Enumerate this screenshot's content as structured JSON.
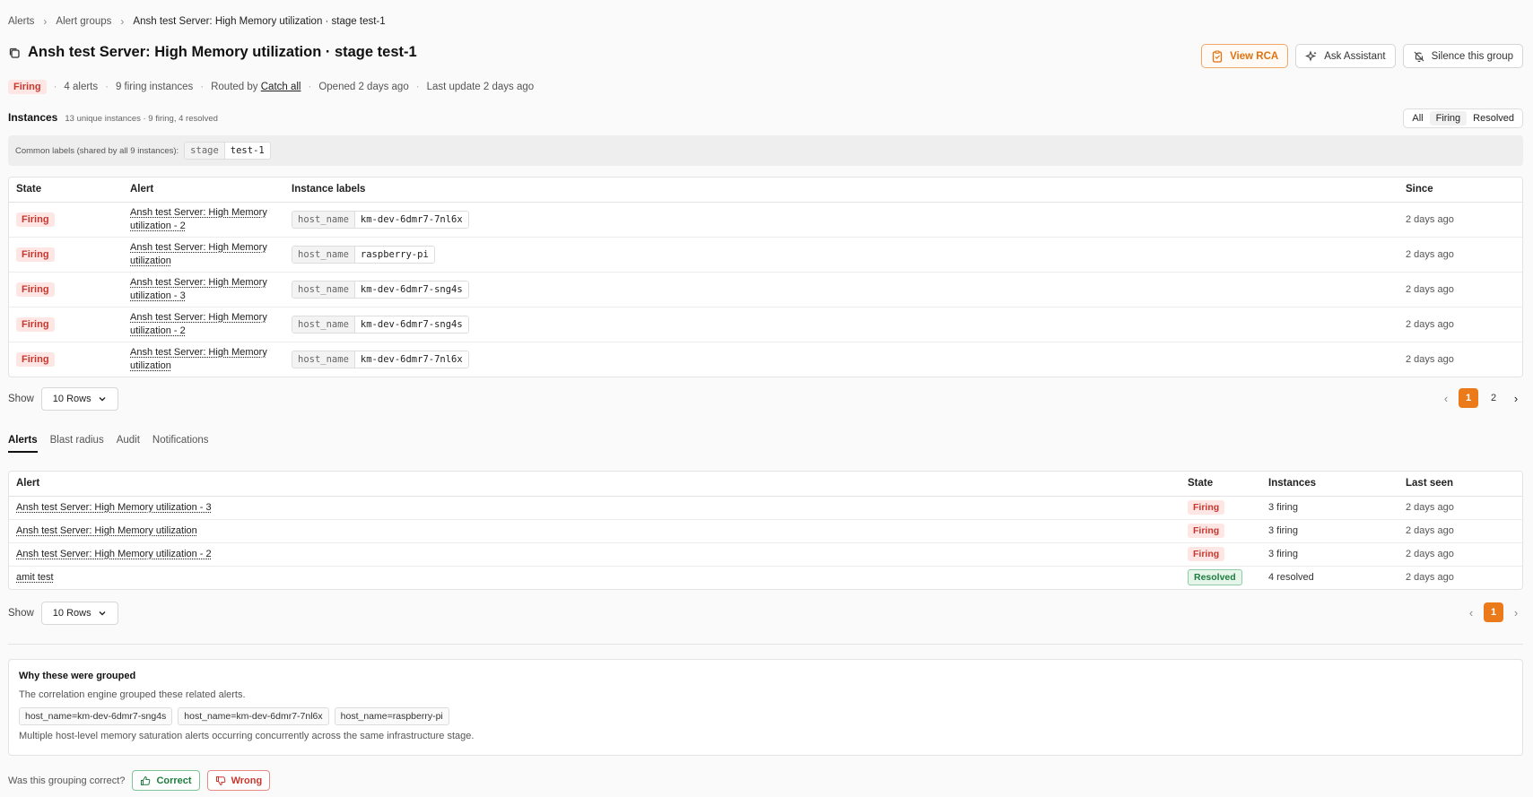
{
  "breadcrumb": {
    "items": [
      "Alerts",
      "Alert groups"
    ],
    "current": "Ansh test Server: High Memory utilization · stage test-1"
  },
  "header": {
    "title": "Ansh test Server: High Memory utilization · stage test-1",
    "actions": {
      "view_rca": "View RCA",
      "ask_assistant": "Ask Assistant",
      "silence": "Silence this group"
    }
  },
  "meta": {
    "state": "Firing",
    "alerts": "4 alerts",
    "firing_instances": "9 firing instances",
    "routed_prefix": "Routed by",
    "routed_link": "Catch all",
    "opened": "Opened 2 days ago",
    "last_update": "Last update 2 days ago"
  },
  "instances": {
    "title": "Instances",
    "subtitle": "13 unique instances · 9 firing, 4 resolved",
    "filters": [
      "All",
      "Firing",
      "Resolved"
    ],
    "active_filter": "Firing",
    "common_label_text": "Common labels (shared by all 9 instances):",
    "common_label": {
      "key": "stage",
      "value": "test-1"
    },
    "columns": [
      "State",
      "Alert",
      "Instance labels",
      "Since"
    ],
    "rows": [
      {
        "state": "Firing",
        "alert_line1": "Ansh test Server: High Memory",
        "alert_line2": "utilization - 2",
        "label_key": "host_name",
        "label_value": "km-dev-6dmr7-7nl6x",
        "since": "2 days ago"
      },
      {
        "state": "Firing",
        "alert_line1": "Ansh test Server: High Memory",
        "alert_line2": "utilization",
        "label_key": "host_name",
        "label_value": "raspberry-pi",
        "since": "2 days ago"
      },
      {
        "state": "Firing",
        "alert_line1": "Ansh test Server: High Memory",
        "alert_line2": "utilization - 3",
        "label_key": "host_name",
        "label_value": "km-dev-6dmr7-sng4s",
        "since": "2 days ago"
      },
      {
        "state": "Firing",
        "alert_line1": "Ansh test Server: High Memory",
        "alert_line2": "utilization - 2",
        "label_key": "host_name",
        "label_value": "km-dev-6dmr7-sng4s",
        "since": "2 days ago"
      },
      {
        "state": "Firing",
        "alert_line1": "Ansh test Server: High Memory",
        "alert_line2": "utilization",
        "label_key": "host_name",
        "label_value": "km-dev-6dmr7-7nl6x",
        "since": "2 days ago"
      }
    ],
    "show_label": "Show",
    "rows_select": "10 Rows",
    "pages": [
      "1",
      "2"
    ],
    "current_page": "1"
  },
  "tabs": {
    "items": [
      "Alerts",
      "Blast radius",
      "Audit",
      "Notifications"
    ],
    "active": "Alerts"
  },
  "alerts": {
    "columns": [
      "Alert",
      "State",
      "Instances",
      "Last seen"
    ],
    "rows": [
      {
        "alert": "Ansh test Server: High Memory utilization - 3",
        "state": "Firing",
        "instances": "3 firing",
        "last_seen": "2 days ago"
      },
      {
        "alert": "Ansh test Server: High Memory utilization",
        "state": "Firing",
        "instances": "3 firing",
        "last_seen": "2 days ago"
      },
      {
        "alert": "Ansh test Server: High Memory utilization - 2",
        "state": "Firing",
        "instances": "3 firing",
        "last_seen": "2 days ago"
      },
      {
        "alert": "amit test",
        "state": "Resolved",
        "instances": "4 resolved",
        "last_seen": "2 days ago"
      }
    ],
    "show_label": "Show",
    "rows_select": "10 Rows",
    "pages": [
      "1"
    ],
    "current_page": "1"
  },
  "why": {
    "title": "Why these were grouped",
    "description": "The correlation engine grouped these related alerts.",
    "chips": [
      "host_name=km-dev-6dmr7-sng4s",
      "host_name=km-dev-6dmr7-7nl6x",
      "host_name=raspberry-pi"
    ],
    "note": "Multiple host-level memory saturation alerts occurring concurrently across the same infrastructure stage."
  },
  "feedback": {
    "question": "Was this grouping correct?",
    "correct": "Correct",
    "wrong": "Wrong"
  },
  "colors": {
    "accent": "#ea7a1a",
    "firing": "#c8372e",
    "resolved": "#1e7d3e"
  }
}
